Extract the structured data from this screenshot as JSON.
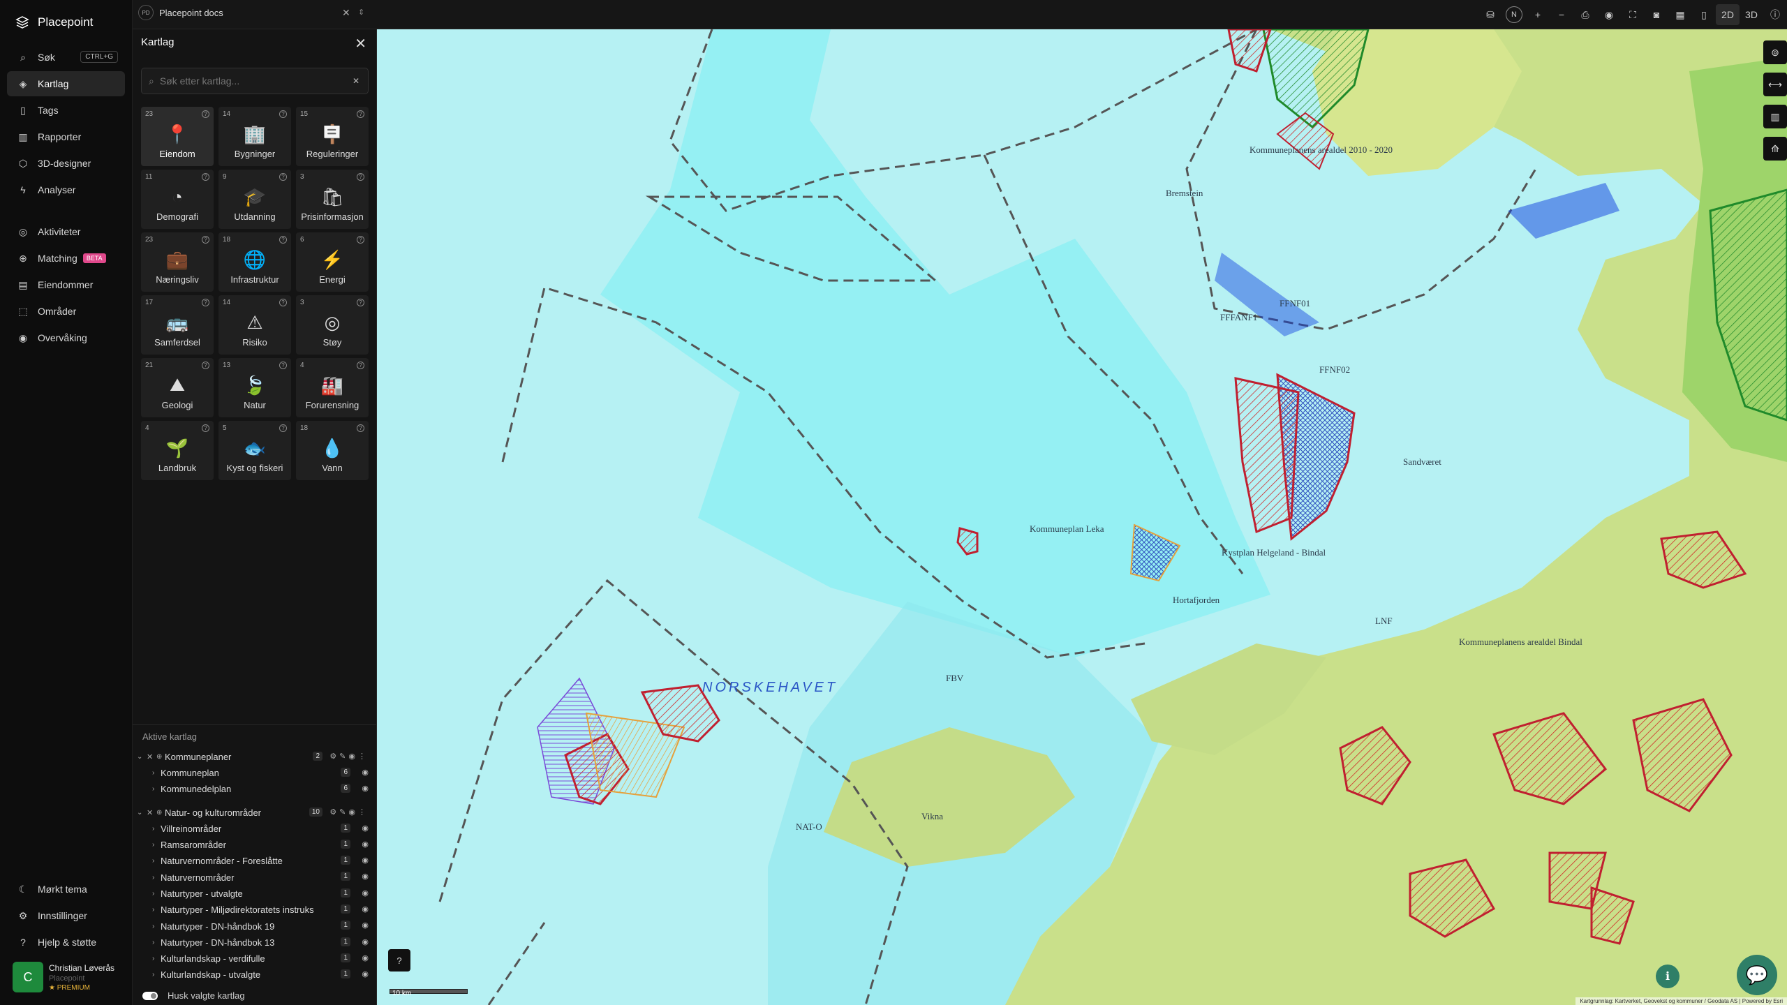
{
  "app": {
    "name": "Placepoint"
  },
  "nav": {
    "items": [
      {
        "label": "Søk",
        "shortcut": "CTRL+G"
      },
      {
        "label": "Kartlag"
      },
      {
        "label": "Tags"
      },
      {
        "label": "Rapporter"
      },
      {
        "label": "3D-designer"
      },
      {
        "label": "Analyser"
      },
      {
        "label": "Aktiviteter"
      },
      {
        "label": "Matching",
        "badge": "BETA"
      },
      {
        "label": "Eiendommer"
      },
      {
        "label": "Områder"
      },
      {
        "label": "Overvåking"
      }
    ],
    "bottom": [
      {
        "label": "Mørkt tema"
      },
      {
        "label": "Innstillinger"
      },
      {
        "label": "Hjelp & støtte"
      }
    ]
  },
  "user": {
    "initial": "C",
    "name": "Christian Løverås",
    "org": "Placepoint",
    "plan": "PREMIUM"
  },
  "tab": {
    "badge": "PD",
    "title": "Placepoint docs"
  },
  "toolbar": {
    "view2d": "2D",
    "view3d": "3D",
    "compass": "N"
  },
  "panel": {
    "title": "Kartlag",
    "search_placeholder": "Søk etter kartlag...",
    "categories": [
      {
        "count": "23",
        "label": "Eiendom",
        "icon": "property-pin-icon"
      },
      {
        "count": "14",
        "label": "Bygninger",
        "icon": "building-icon"
      },
      {
        "count": "15",
        "label": "Reguleringer",
        "icon": "signpost-icon"
      },
      {
        "count": "11",
        "label": "Demografi",
        "icon": "demography-icon"
      },
      {
        "count": "9",
        "label": "Utdanning",
        "icon": "graduation-cap-icon"
      },
      {
        "count": "3",
        "label": "Prisinformasjon",
        "icon": "price-bag-icon"
      },
      {
        "count": "23",
        "label": "Næringsliv",
        "icon": "business-bag-icon"
      },
      {
        "count": "18",
        "label": "Infrastruktur",
        "icon": "infrastructure-icon"
      },
      {
        "count": "6",
        "label": "Energi",
        "icon": "lightning-icon"
      },
      {
        "count": "17",
        "label": "Samferdsel",
        "icon": "bus-icon"
      },
      {
        "count": "14",
        "label": "Risiko",
        "icon": "risk-icon"
      },
      {
        "count": "3",
        "label": "Støy",
        "icon": "noise-icon"
      },
      {
        "count": "21",
        "label": "Geologi",
        "icon": "geology-icon"
      },
      {
        "count": "13",
        "label": "Natur",
        "icon": "leaf-icon"
      },
      {
        "count": "4",
        "label": "Forurensning",
        "icon": "factory-icon"
      },
      {
        "count": "4",
        "label": "Landbruk",
        "icon": "sprout-icon"
      },
      {
        "count": "5",
        "label": "Kyst og fiskeri",
        "icon": "fish-icon"
      },
      {
        "count": "18",
        "label": "Vann",
        "icon": "water-drop-icon"
      }
    ],
    "active_title": "Aktive kartlag",
    "groups": [
      {
        "name": "Kommuneplaner",
        "count": "2",
        "layers": [
          {
            "name": "Kommuneplan",
            "count": "6"
          },
          {
            "name": "Kommunedelplan",
            "count": "6"
          }
        ]
      },
      {
        "name": "Natur- og kulturområder",
        "count": "10",
        "layers": [
          {
            "name": "Villreinområder",
            "count": "1"
          },
          {
            "name": "Ramsarområder",
            "count": "1"
          },
          {
            "name": "Naturvernområder - Foreslåtte",
            "count": "1"
          },
          {
            "name": "Naturvernområder",
            "count": "1"
          },
          {
            "name": "Naturtyper - utvalgte",
            "count": "1"
          },
          {
            "name": "Naturtyper - Miljødirektoratets instruks",
            "count": "1"
          },
          {
            "name": "Naturtyper - DN-håndbok 19",
            "count": "1"
          },
          {
            "name": "Naturtyper - DN-håndbok 13",
            "count": "1"
          },
          {
            "name": "Kulturlandskap - verdifulle",
            "count": "1"
          },
          {
            "name": "Kulturlandskap - utvalgte",
            "count": "1"
          }
        ]
      }
    ],
    "remember_label": "Husk valgte kartlag"
  },
  "map": {
    "sea_label": "NORSKEHAVET",
    "labels": [
      "Kommuneplan Leka",
      "Kystplan Helgeland - Bindal",
      "Bremstein",
      "Kommuneplanens arealdel 2010 - 2020",
      "FFFANF1",
      "FFNF01",
      "FFNF02",
      "Sandværet",
      "Hortafjorden",
      "Vikna",
      "FBV",
      "NAT-O",
      "LNF",
      "Kommuneplanens arealdel Bindal"
    ],
    "scale_label": "10 km",
    "attribution": "Kartgrunnlag: Kartverket, Geovekst og kommuner / Geodata AS | Powered by Esri"
  },
  "colors": {
    "accent": "#2f7f67",
    "sidebar_bg": "#0d0d0d",
    "panel_bg": "#141414",
    "sea": "#b6f1f3",
    "land": "#c9e08a"
  }
}
